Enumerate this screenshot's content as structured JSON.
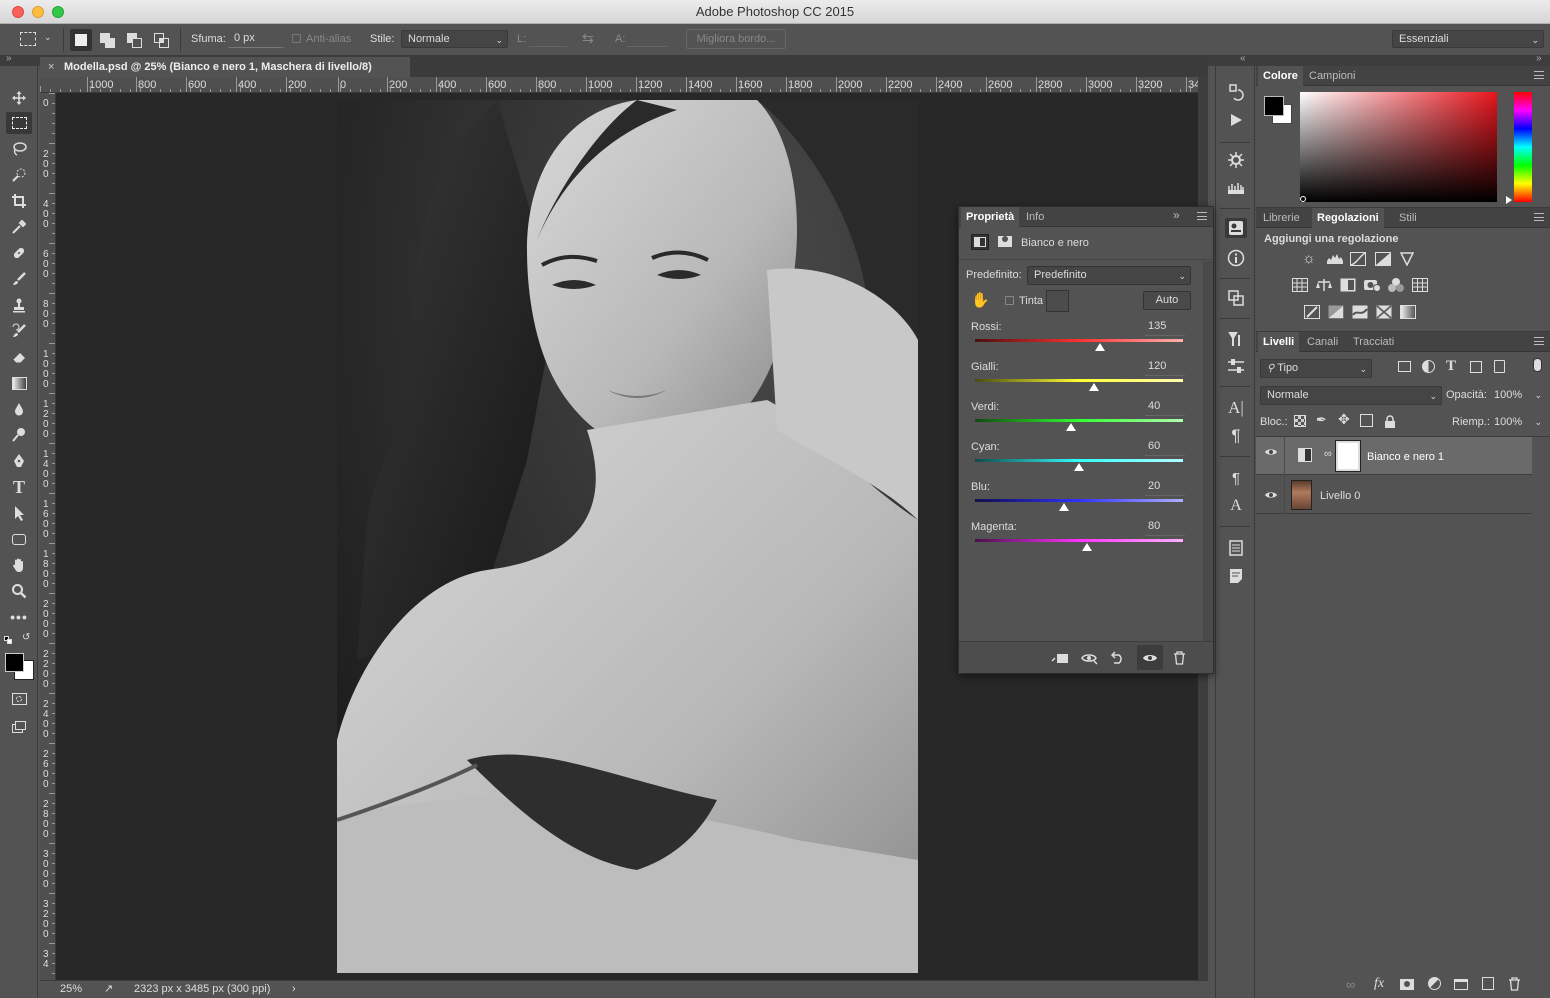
{
  "window": {
    "title": "Adobe Photoshop CC 2015"
  },
  "options": {
    "feather_label": "Sfuma:",
    "feather_value": "0 px",
    "antialias_label": "Anti-alias",
    "style_label": "Stile:",
    "style_value": "Normale",
    "width_label": "L:",
    "height_label": "A:",
    "refine_edge": "Migliora bordo...",
    "workspace": "Essenziali"
  },
  "document": {
    "tab_title": "Modella.psd @ 25% (Bianco e nero 1, Maschera di livello/8)",
    "zoom": "25%",
    "info": "2323 px x 3485 px (300 ppi)",
    "ruler_top": [
      "1000",
      "800",
      "600",
      "400",
      "200",
      "0",
      "200",
      "400",
      "600",
      "800",
      "1000",
      "1200",
      "1400",
      "1600",
      "1800",
      "2000",
      "2200",
      "2400",
      "2600",
      "2800",
      "3000",
      "3200",
      "34"
    ],
    "ruler_left": [
      "0",
      "200",
      "400",
      "600",
      "800",
      "1000",
      "1200",
      "1400",
      "1600",
      "1800",
      "2000",
      "2200",
      "2400",
      "2600",
      "2800",
      "3000",
      "3200",
      "34"
    ]
  },
  "color_panel": {
    "tabs": [
      "Colore",
      "Campioni"
    ],
    "foreground": "#000000",
    "background": "#ffffff"
  },
  "adjustments_panel": {
    "tabs": [
      "Librerie",
      "Regolazioni",
      "Stili"
    ],
    "heading": "Aggiungi una regolazione"
  },
  "layers_panel": {
    "tabs": [
      "Livelli",
      "Canali",
      "Tracciati"
    ],
    "filter": "Tipo",
    "blend_mode": "Normale",
    "opacity_label": "Opacità:",
    "opacity_value": "100%",
    "lock_label": "Bloc.:",
    "fill_label": "Riemp.:",
    "fill_value": "100%",
    "layers": [
      {
        "name": "Bianco e nero 1",
        "selected": true
      },
      {
        "name": "Livello 0",
        "selected": false
      }
    ]
  },
  "properties_panel": {
    "tabs": [
      "Proprietà",
      "Info"
    ],
    "title": "Bianco e nero",
    "preset_label": "Predefinito:",
    "preset_value": "Predefinito",
    "tint_label": "Tinta",
    "auto_label": "Auto",
    "sliders": [
      {
        "name": "Rossi:",
        "value": "135",
        "pos": 0.6
      },
      {
        "name": "Gialli:",
        "value": "120",
        "pos": 0.57
      },
      {
        "name": "Verdi:",
        "value": "40",
        "pos": 0.46
      },
      {
        "name": "Cyan:",
        "value": "60",
        "pos": 0.5
      },
      {
        "name": "Blu:",
        "value": "20",
        "pos": 0.43
      },
      {
        "name": "Magenta:",
        "value": "80",
        "pos": 0.54
      }
    ]
  }
}
